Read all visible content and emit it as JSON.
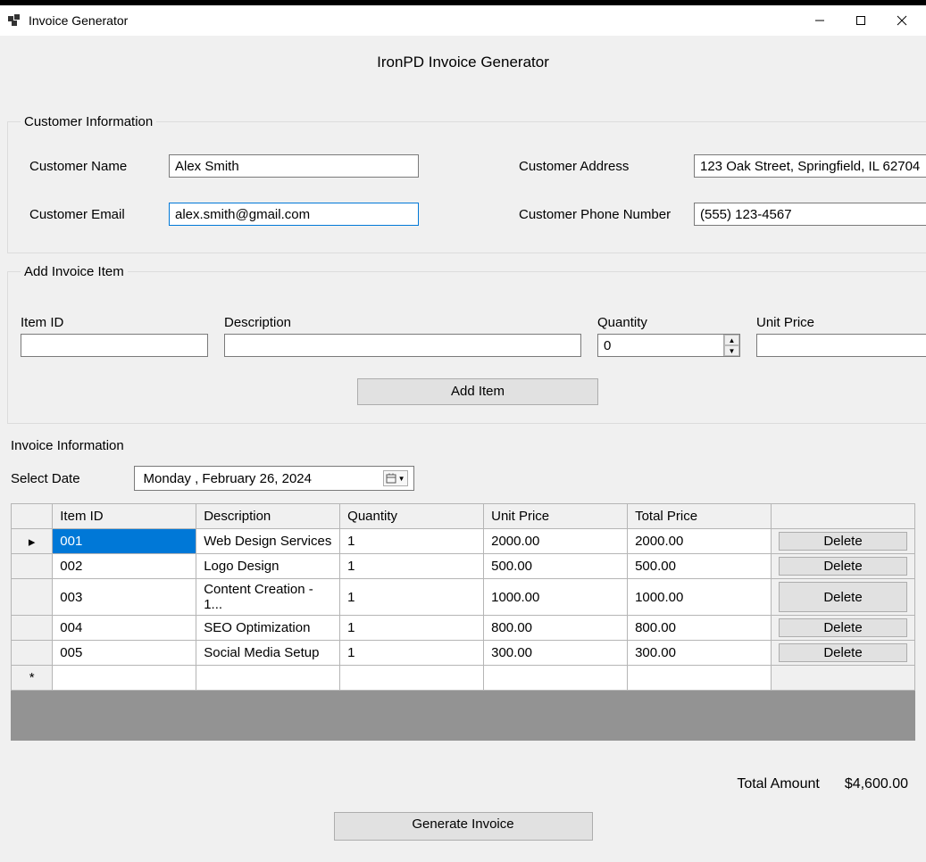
{
  "window": {
    "title": "Invoice Generator"
  },
  "header": {
    "title": "IronPD Invoice Generator"
  },
  "customer": {
    "legend": "Customer Information",
    "name_label": "Customer Name",
    "name_value": "Alex Smith",
    "email_label": "Customer Email",
    "email_value": "alex.smith@gmail.com",
    "address_label": "Customer Address",
    "address_value": "123 Oak Street, Springfield, IL 62704",
    "phone_label": "Customer Phone Number",
    "phone_value": "(555) 123-4567"
  },
  "add_item": {
    "legend": "Add Invoice Item",
    "itemid_label": "Item ID",
    "itemid_value": "",
    "desc_label": "Description",
    "desc_value": "",
    "qty_label": "Quantity",
    "qty_value": "0",
    "price_label": "Unit Price",
    "price_value": "",
    "add_button": "Add Item"
  },
  "invoice": {
    "legend": "Invoice Information",
    "date_label": "Select Date",
    "date_value": "Monday   ,   February   26, 2024",
    "columns": {
      "itemid": "Item ID",
      "description": "Description",
      "quantity": "Quantity",
      "unit_price": "Unit Price",
      "total_price": "Total Price"
    },
    "delete_label": "Delete",
    "rows": [
      {
        "itemid": "001",
        "description": "Web Design Services",
        "quantity": "1",
        "unit_price": "2000.00",
        "total_price": "2000.00"
      },
      {
        "itemid": "002",
        "description": "Logo Design",
        "quantity": "1",
        "unit_price": "500.00",
        "total_price": "500.00"
      },
      {
        "itemid": "003",
        "description": "Content Creation - 1...",
        "quantity": "1",
        "unit_price": "1000.00",
        "total_price": "1000.00"
      },
      {
        "itemid": "004",
        "description": "SEO Optimization",
        "quantity": "1",
        "unit_price": "800.00",
        "total_price": "800.00"
      },
      {
        "itemid": "005",
        "description": "Social Media Setup",
        "quantity": "1",
        "unit_price": "300.00",
        "total_price": "300.00"
      }
    ]
  },
  "totals": {
    "label": "Total Amount",
    "value": "$4,600.00"
  },
  "actions": {
    "generate": "Generate Invoice"
  }
}
